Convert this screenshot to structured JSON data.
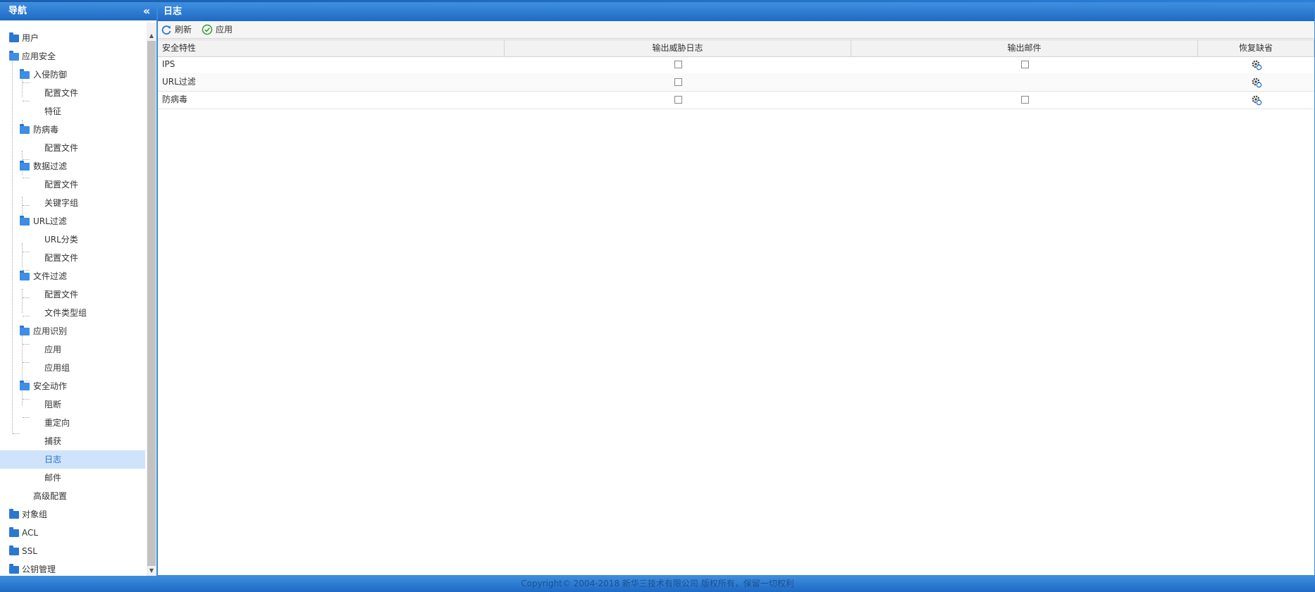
{
  "nav": {
    "title": "导航",
    "collapse_icon": "double-chevron-left-icon",
    "items": [
      {
        "label": "用户",
        "icon": "folder-icon"
      },
      {
        "label": "应用安全",
        "icon": "folder-open-icon"
      },
      {
        "label": "入侵防御",
        "icon": "folder-open-icon"
      },
      {
        "label": "配置文件"
      },
      {
        "label": "特征"
      },
      {
        "label": "防病毒",
        "icon": "folder-open-icon"
      },
      {
        "label": "配置文件"
      },
      {
        "label": "数据过滤",
        "icon": "folder-open-icon"
      },
      {
        "label": "配置文件"
      },
      {
        "label": "关键字组"
      },
      {
        "label": "URL过滤",
        "icon": "folder-open-icon"
      },
      {
        "label": "URL分类"
      },
      {
        "label": "配置文件"
      },
      {
        "label": "文件过滤",
        "icon": "folder-open-icon"
      },
      {
        "label": "配置文件"
      },
      {
        "label": "文件类型组"
      },
      {
        "label": "应用识别",
        "icon": "folder-open-icon"
      },
      {
        "label": "应用"
      },
      {
        "label": "应用组"
      },
      {
        "label": "安全动作",
        "icon": "folder-open-icon"
      },
      {
        "label": "阻断"
      },
      {
        "label": "重定向"
      },
      {
        "label": "捕获"
      },
      {
        "label": "日志",
        "selected": true
      },
      {
        "label": "邮件"
      },
      {
        "label": "高级配置"
      },
      {
        "label": "对象组",
        "icon": "folder-icon"
      },
      {
        "label": "ACL",
        "icon": "folder-icon"
      },
      {
        "label": "SSL",
        "icon": "folder-icon"
      },
      {
        "label": "公钥管理",
        "icon": "folder-icon"
      }
    ]
  },
  "main": {
    "title": "日志",
    "toolbar": {
      "refresh_label": "刷新",
      "refresh_icon": "refresh-icon",
      "apply_label": "应用",
      "apply_icon": "check-circle-icon"
    },
    "table": {
      "columns": [
        "安全特性",
        "输出威胁日志",
        "输出邮件",
        "恢复缺省"
      ],
      "rows": [
        {
          "feature": "IPS",
          "threat_log": false,
          "mail": false,
          "has_mail": true,
          "restore_icon": "gear-restore-icon"
        },
        {
          "feature": "URL过滤",
          "threat_log": false,
          "has_mail": false,
          "restore_icon": "gear-restore-icon"
        },
        {
          "feature": "防病毒",
          "threat_log": false,
          "mail": false,
          "has_mail": true,
          "restore_icon": "gear-restore-icon"
        }
      ]
    }
  },
  "footer": {
    "copyright": "Copyright© 2004-2018 新华三技术有限公司 版权所有，保留一切权利"
  },
  "colors": {
    "header_blue": "#2a78d0",
    "selected_bg": "#cfe3fb",
    "selected_text": "#1f6fd0"
  }
}
